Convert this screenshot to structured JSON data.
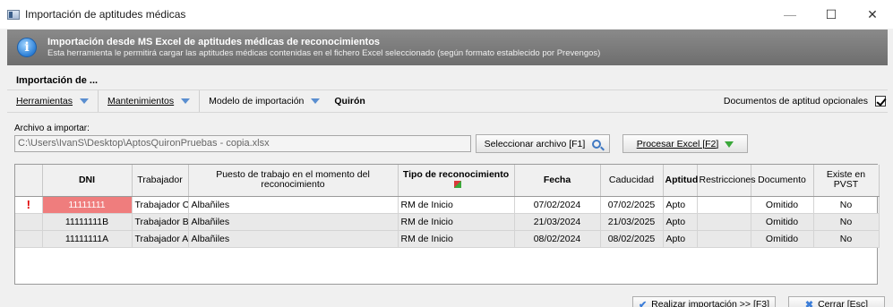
{
  "window": {
    "title": "Importación de aptitudes médicas",
    "minimize": "—",
    "maximize": "☐",
    "close": "✕"
  },
  "banner": {
    "icon": "info-icon",
    "title": "Importación desde MS Excel de aptitudes médicas de reconocimientos",
    "subtitle": "Esta herramienta le permitirá cargar las aptitudes médicas contenidas en el fichero Excel seleccionado (según formato establecido por Prevengos)"
  },
  "section": {
    "title": "Importación de ..."
  },
  "toolbar": {
    "herramientas": "Herramientas",
    "mantenimientos": "Mantenimientos",
    "modelo_label": "Modelo de importación",
    "modelo_value": "Quirón",
    "docs_optional_label": "Documentos de aptitud opcionales",
    "docs_optional_checked": true
  },
  "file": {
    "label": "Archivo a importar:",
    "path": "C:\\Users\\IvanS\\Desktop\\AptosQuironPruebas - copia.xlsx",
    "select_button": "Seleccionar archivo  [F1]",
    "process_button": "Procesar Excel  [F2]"
  },
  "grid": {
    "columns": [
      "",
      "DNI",
      "Trabajador",
      "Puesto de trabajo en el momento del reconocimiento",
      "Tipo de reconocimiento",
      "Fecha",
      "Caducidad",
      "Aptitud",
      "Restricciones",
      "Documento",
      "Existe en PVST"
    ],
    "rows": [
      {
        "indicator": "!",
        "dni": "11111111",
        "trabajador": "Trabajador C",
        "puesto": "Albañiles",
        "tipo": "RM de Inicio",
        "fecha": "07/02/2024",
        "caducidad": "07/02/2025",
        "aptitud": "Apto",
        "restricciones": "",
        "documento": "Omitido",
        "existe": "No"
      },
      {
        "indicator": "",
        "dni": "11111111B",
        "trabajador": "Trabajador B",
        "puesto": "Albañiles",
        "tipo": "RM de Inicio",
        "fecha": "21/03/2024",
        "caducidad": "21/03/2025",
        "aptitud": "Apto",
        "restricciones": "",
        "documento": "Omitido",
        "existe": "No"
      },
      {
        "indicator": "",
        "dni": "11111111A",
        "trabajador": "Trabajador A",
        "puesto": "Albañiles",
        "tipo": "RM de Inicio",
        "fecha": "08/02/2024",
        "caducidad": "08/02/2025",
        "aptitud": "Apto",
        "restricciones": "",
        "documento": "Omitido",
        "existe": "No"
      }
    ]
  },
  "footer": {
    "import_button": "Realizar importación >>  [F3]",
    "close_button": "Cerrar  [Esc]"
  },
  "colors": {
    "error_cell": "#ef7d7d",
    "banner": "#7a7a7a",
    "accent": "#3b7dd8"
  }
}
